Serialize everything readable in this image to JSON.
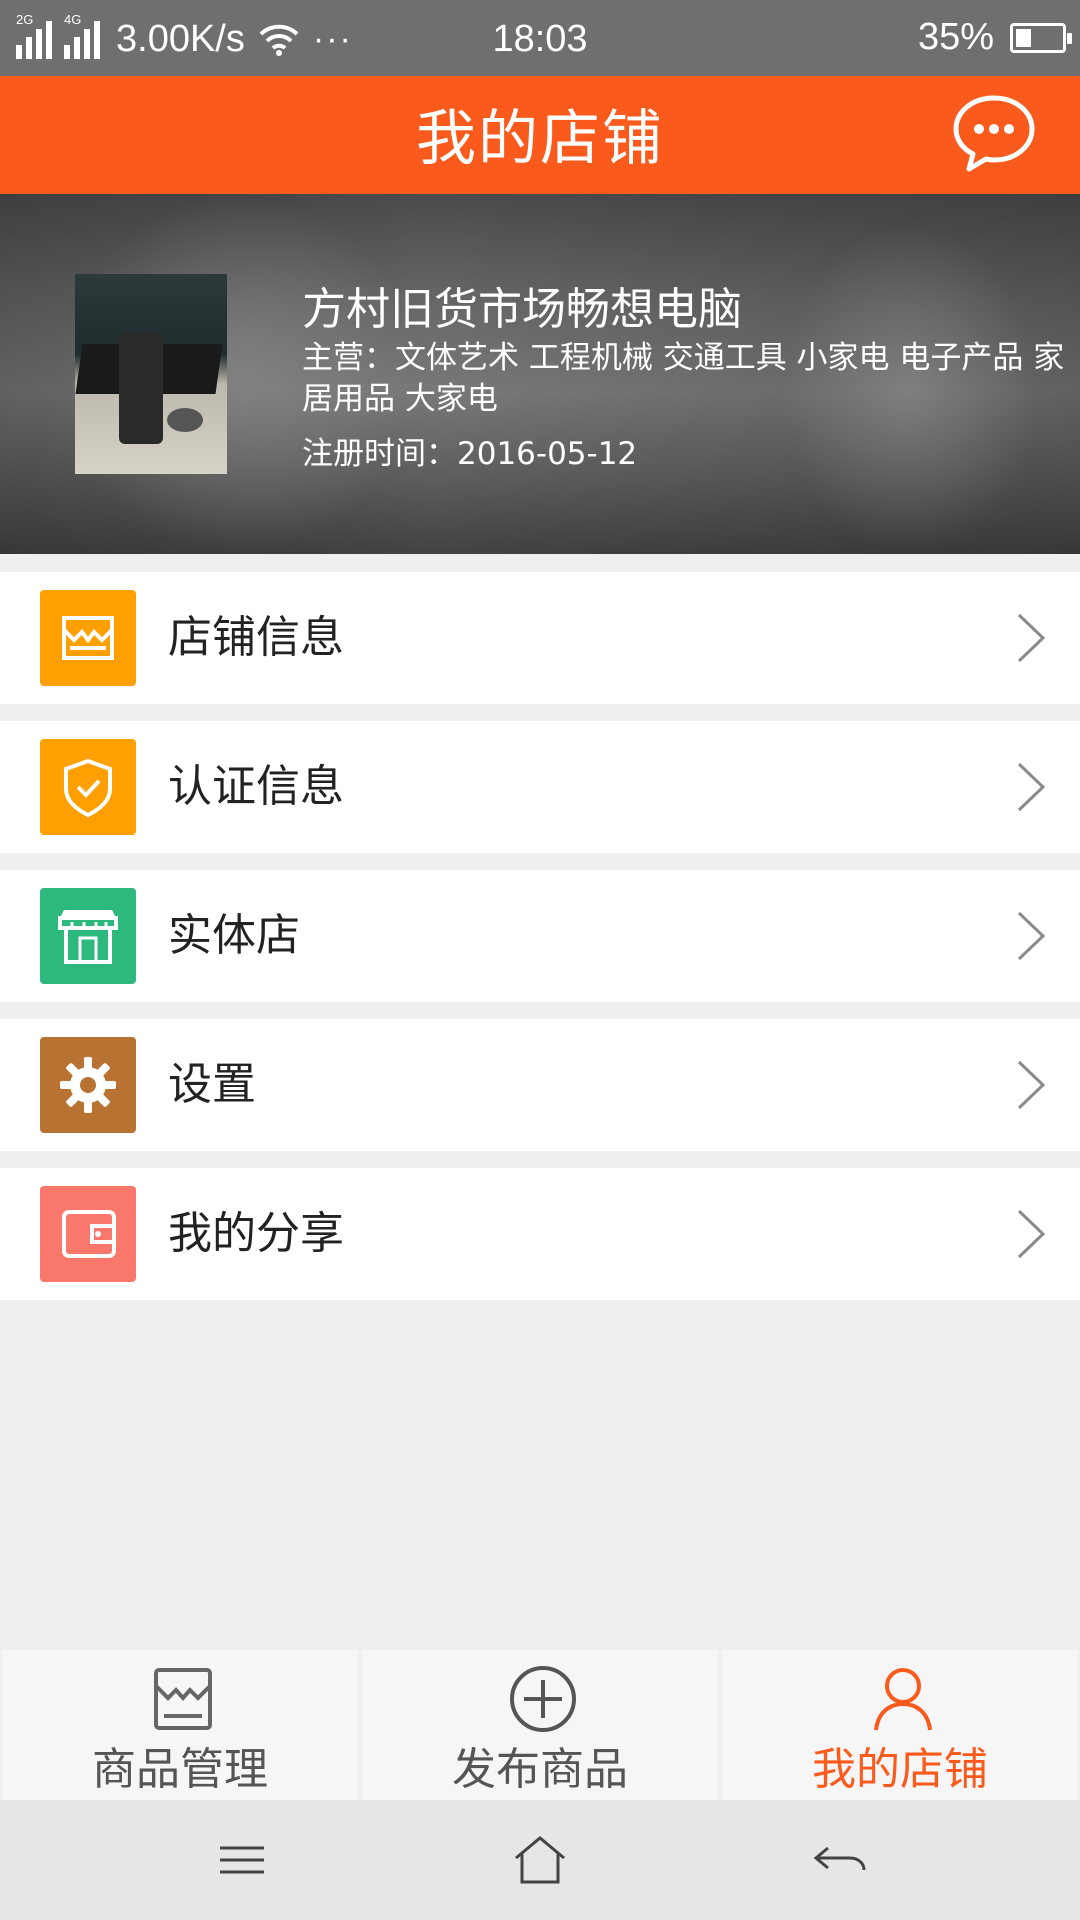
{
  "status_bar": {
    "signal1_tag": "2G",
    "signal2_tag": "4G",
    "speed": "3.00K/s",
    "dots": "···",
    "time": "18:03",
    "battery": "35%",
    "battery_level": 0.35
  },
  "header": {
    "title": "我的店铺",
    "chat_icon": "chat-bubble-icon",
    "accent_color": "#fa5a1b"
  },
  "profile": {
    "shop_name": "方村旧货市场畅想电脑",
    "main_business": "主营：文体艺术  工程机械  交通工具  小家电  电子产品  家居用品  大家电",
    "register_time": "注册时间：2016-05-12"
  },
  "menu": [
    {
      "label": "店铺信息",
      "icon": "shop-info-icon",
      "color": "#ffa000"
    },
    {
      "label": "认证信息",
      "icon": "shield-check-icon",
      "color": "#ffa000"
    },
    {
      "label": "实体店",
      "icon": "storefront-icon",
      "color": "#2db87d"
    },
    {
      "label": "设置",
      "icon": "gear-icon",
      "color": "#b87333"
    },
    {
      "label": "我的分享",
      "icon": "wallet-icon",
      "color": "#f9786b"
    }
  ],
  "tabs": [
    {
      "label": "商品管理",
      "icon": "shop-bag-icon",
      "active": false
    },
    {
      "label": "发布商品",
      "icon": "plus-circle-icon",
      "active": false
    },
    {
      "label": "我的店铺",
      "icon": "person-icon",
      "active": true
    }
  ],
  "system_nav": {
    "menu": "menu-lines-icon",
    "home": "home-icon",
    "back": "back-arrow-icon"
  }
}
